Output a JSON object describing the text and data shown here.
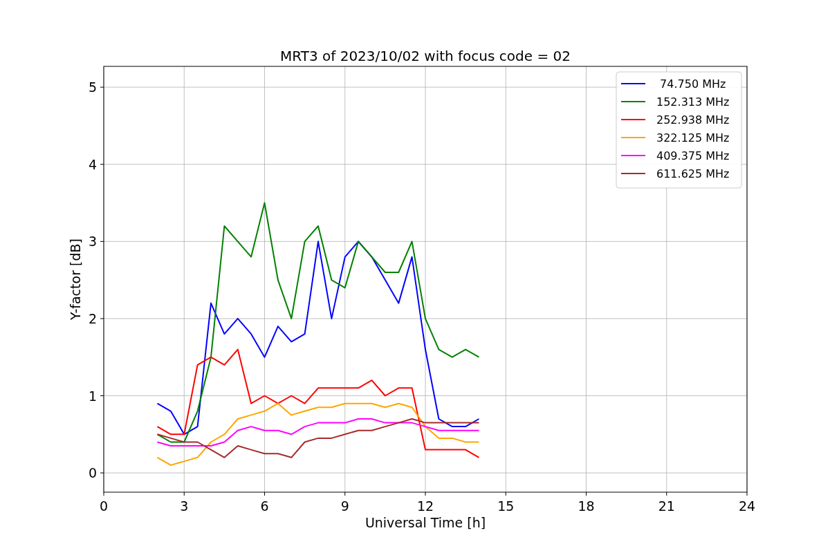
{
  "figure": {
    "chart_data": {
      "type": "line",
      "title": "MRT3 of 2023/10/02 with focus code = 02",
      "xlabel": "Universal Time [h]",
      "ylabel": "Y-factor [dB]",
      "x": [
        2,
        2.5,
        3,
        3.5,
        4,
        4.5,
        5,
        5.5,
        6,
        6.5,
        7,
        7.5,
        8,
        8.5,
        9,
        9.5,
        10,
        10.5,
        11,
        11.5,
        12,
        12.5,
        13,
        13.5,
        14
      ],
      "series": [
        {
          "name": " 74.750 MHz",
          "color": "#0000ff",
          "values": [
            0.9,
            0.8,
            0.5,
            0.6,
            2.2,
            1.8,
            2.0,
            1.8,
            1.5,
            1.9,
            1.7,
            1.8,
            3.0,
            2.0,
            2.8,
            3.0,
            2.8,
            2.5,
            2.2,
            2.8,
            1.6,
            0.7,
            0.6,
            0.6,
            0.7
          ]
        },
        {
          "name": "152.313 MHz",
          "color": "#008000",
          "values": [
            0.5,
            0.4,
            0.4,
            0.8,
            1.5,
            3.2,
            3.0,
            2.8,
            3.5,
            2.5,
            2.0,
            3.0,
            3.2,
            2.5,
            2.4,
            3.0,
            2.8,
            2.6,
            2.6,
            3.0,
            2.0,
            1.6,
            1.5,
            1.6,
            1.5
          ]
        },
        {
          "name": "252.938 MHz",
          "color": "#ff0000",
          "values": [
            0.6,
            0.5,
            0.5,
            1.4,
            1.5,
            1.4,
            1.6,
            0.9,
            1.0,
            0.9,
            1.0,
            0.9,
            1.1,
            1.1,
            1.1,
            1.1,
            1.2,
            1.0,
            1.1,
            1.1,
            0.3,
            0.3,
            0.3,
            0.3,
            0.2
          ]
        },
        {
          "name": "322.125 MHz",
          "color": "#ffa500",
          "values": [
            0.2,
            0.1,
            0.15,
            0.2,
            0.4,
            0.5,
            0.7,
            0.75,
            0.8,
            0.9,
            0.75,
            0.8,
            0.85,
            0.85,
            0.9,
            0.9,
            0.9,
            0.85,
            0.9,
            0.85,
            0.6,
            0.45,
            0.45,
            0.4,
            0.4
          ]
        },
        {
          "name": "409.375 MHz",
          "color": "#ff00ff",
          "values": [
            0.4,
            0.35,
            0.35,
            0.35,
            0.35,
            0.4,
            0.55,
            0.6,
            0.55,
            0.55,
            0.5,
            0.6,
            0.65,
            0.65,
            0.65,
            0.7,
            0.7,
            0.65,
            0.65,
            0.65,
            0.6,
            0.55,
            0.55,
            0.55,
            0.55
          ]
        },
        {
          "name": "611.625 MHz",
          "color": "#a52a2a",
          "values": [
            0.5,
            0.45,
            0.4,
            0.4,
            0.3,
            0.2,
            0.35,
            0.3,
            0.25,
            0.25,
            0.2,
            0.4,
            0.45,
            0.45,
            0.5,
            0.55,
            0.55,
            0.6,
            0.65,
            0.7,
            0.65,
            0.65,
            0.65,
            0.65,
            0.65
          ]
        }
      ],
      "xlim": [
        0,
        24
      ],
      "ylim": [
        -0.25,
        5.27
      ],
      "xticks": [
        0,
        3,
        6,
        9,
        12,
        15,
        18,
        21,
        24
      ],
      "yticks": [
        0,
        1,
        2,
        3,
        4,
        5
      ],
      "grid": true,
      "legend": true
    }
  }
}
